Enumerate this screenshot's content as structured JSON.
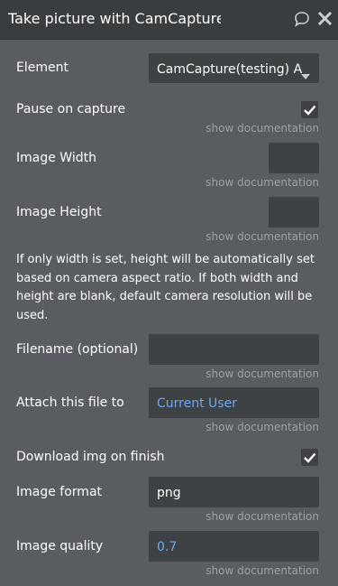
{
  "header": {
    "title": "Take picture with CamCapture(testing)",
    "icons": [
      "comment-icon",
      "close-icon"
    ]
  },
  "fields": {
    "element": {
      "label": "Element",
      "value": "CamCapture(testing) A"
    },
    "pause_on_capture": {
      "label": "Pause on capture",
      "checked": true
    },
    "image_width": {
      "label": "Image Width",
      "value": ""
    },
    "image_height": {
      "label": "Image Height",
      "value": ""
    },
    "size_note": "If only width is set, height will be automatically set based on camera aspect ratio. If both width and height are blank, default camera resolution will be used.",
    "filename": {
      "label": "Filename (optional)",
      "value": ""
    },
    "attach": {
      "label": "Attach this file to",
      "value": "Current User"
    },
    "download": {
      "label": "Download img on finish",
      "checked": true
    },
    "format": {
      "label": "Image format",
      "value": "png"
    },
    "quality": {
      "label": "Image quality",
      "value": "0.7"
    }
  },
  "doc_link": "show documentation",
  "colors": {
    "panel_bg": "#595d61",
    "header_bg": "#3a3d40",
    "field_bg": "#3f4245",
    "dynamic_text": "#6aa7f0",
    "doc_link": "#9ba1a6"
  }
}
